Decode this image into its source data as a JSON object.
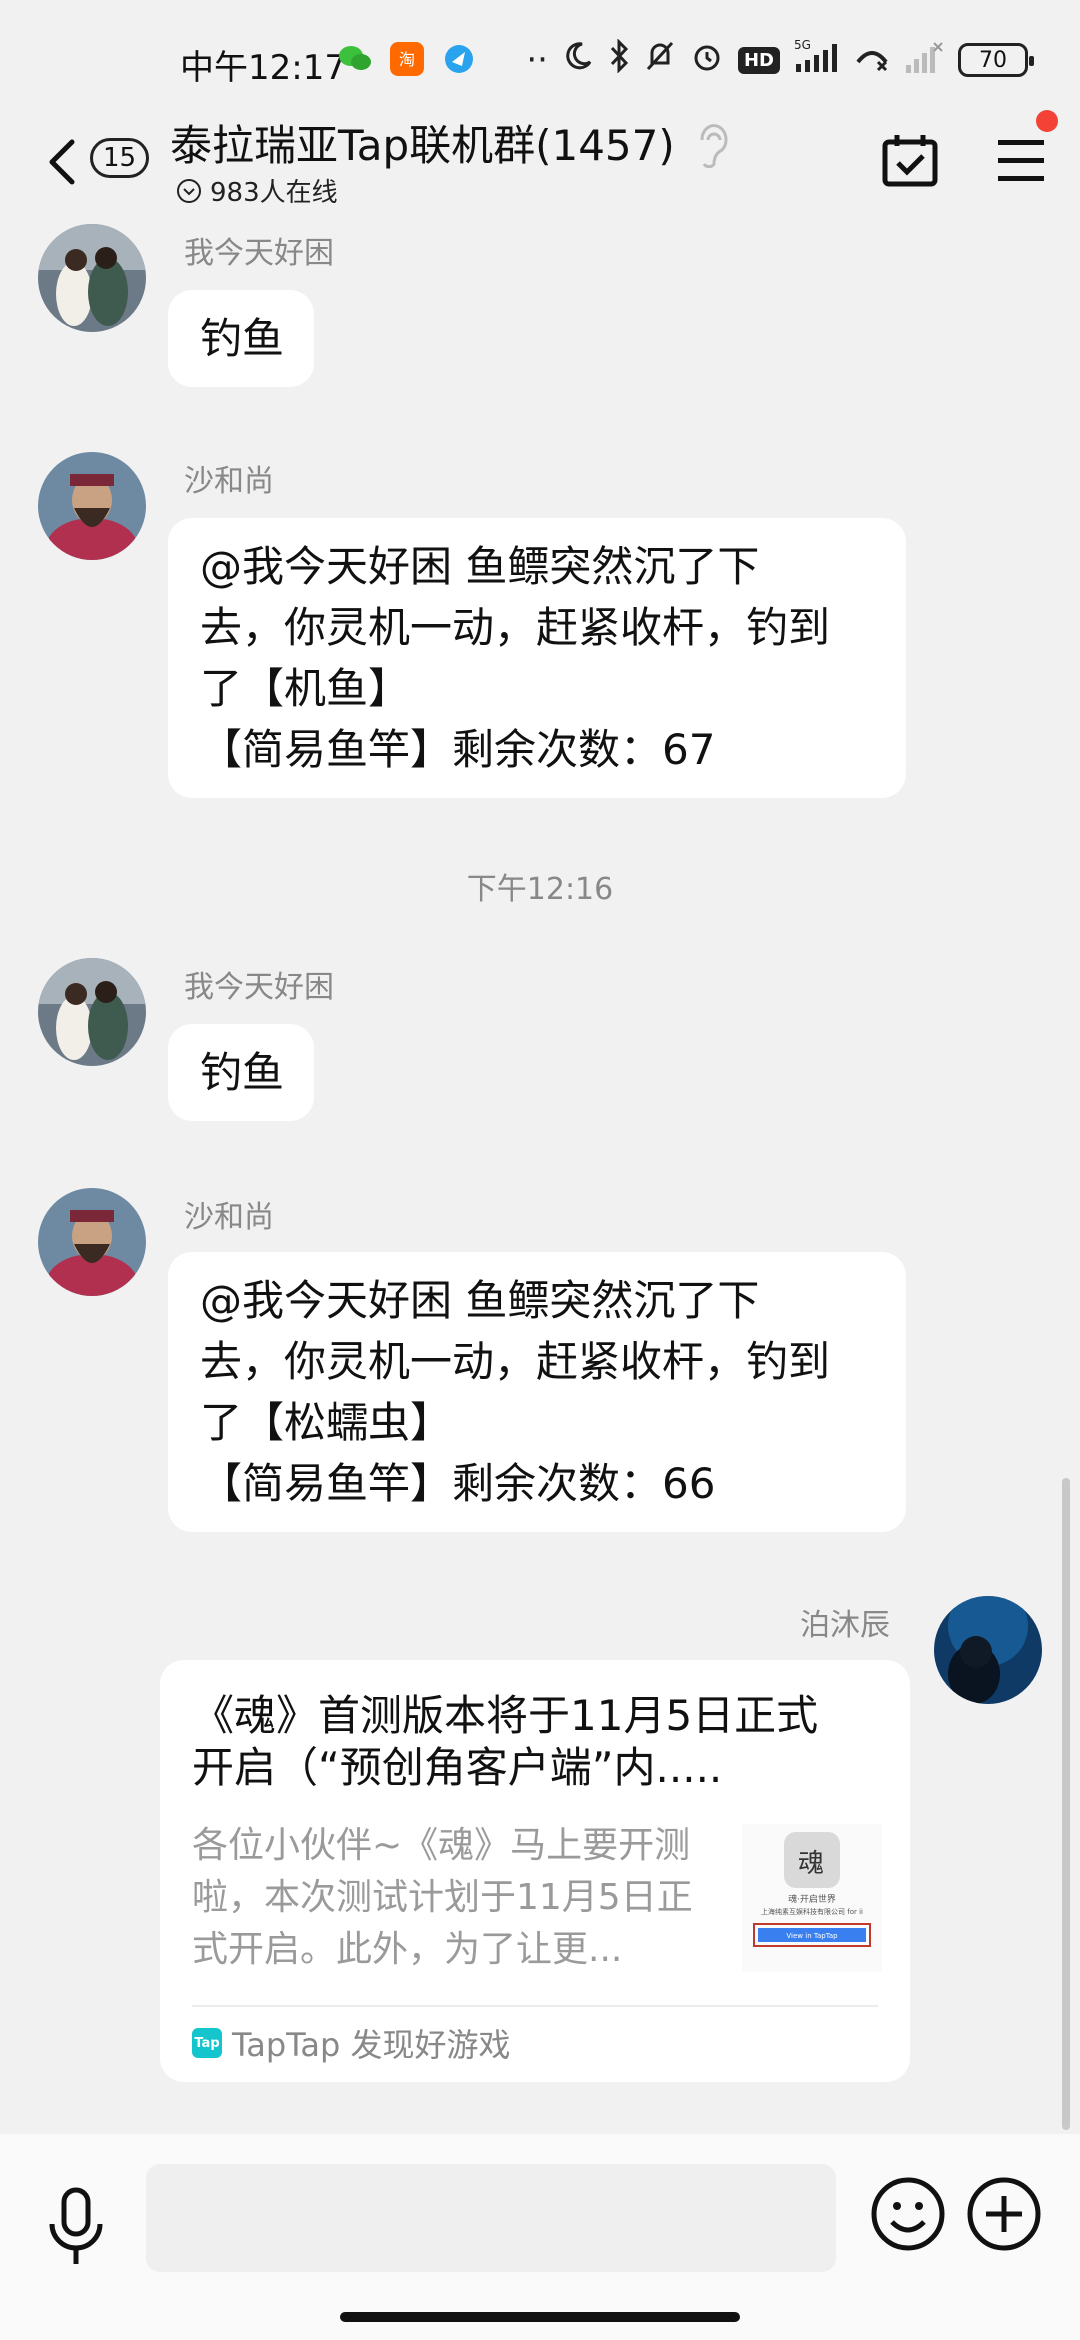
{
  "status_bar": {
    "time": "中午12:17",
    "network": "5G",
    "battery": "70"
  },
  "header": {
    "back_badge": "15",
    "title": "泰拉瑞亚Tap联机群(1457)",
    "online": "983人在线"
  },
  "messages": [
    {
      "sender": "我今天好困",
      "lines": [
        "钓鱼"
      ]
    },
    {
      "sender": "沙和尚",
      "lines": [
        "@我今天好困 鱼鳔突然沉了下",
        "去，你灵机一动，赶紧收杆，钓到",
        "了【机鱼】",
        "【简易鱼竿】剩余次数：67"
      ]
    },
    {
      "timestamp": "下午12:16"
    },
    {
      "sender": "我今天好困",
      "lines": [
        "钓鱼"
      ]
    },
    {
      "sender": "沙和尚",
      "lines": [
        "@我今天好困 鱼鳔突然沉了下",
        "去，你灵机一动，赶紧收杆，钓到",
        "了【松蠕虫】",
        "【简易鱼竿】剩余次数：66"
      ]
    },
    {
      "sender": "泊沐辰",
      "card": {
        "title_lines": [
          "《魂》首测版本将于11月5日正式",
          "开启（“预创角客户端”内....."
        ],
        "desc_lines": [
          "各位小伙伴~《魂》马上要开测",
          "啦，本次测试计划于11月5日正",
          "式开启。此外，为了让更..."
        ],
        "source": "TapTap 发现好游戏",
        "thumb_app_label": "魂",
        "thumb_line1": "魂·开启世界",
        "thumb_line2": "上海纯素互娱科技有限公司 for ii",
        "thumb_button": "View in TapTap"
      }
    }
  ],
  "icons": {
    "back": "chevron-left-icon",
    "ear": "ear-icon",
    "calendar": "calendar-check-icon",
    "menu": "hamburger-menu-icon",
    "voice": "microphone-icon",
    "emoji": "smiley-icon",
    "plus": "plus-circle-icon"
  },
  "colors": {
    "background": "#f1f1f1",
    "bubble": "#ffffff",
    "notification_dot": "#f44336",
    "taptap_brand": "#15c5ce"
  }
}
